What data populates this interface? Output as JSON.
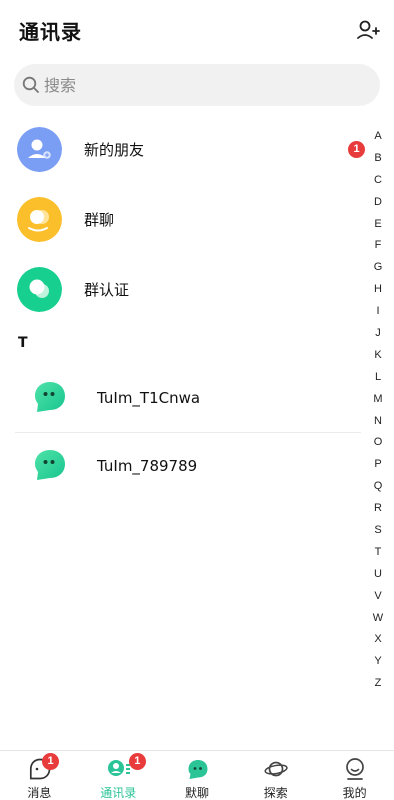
{
  "header": {
    "title": "通讯录",
    "add_friend_icon": "person-add-icon"
  },
  "search": {
    "placeholder": "搜索",
    "value": "",
    "icon": "search-icon"
  },
  "actions": [
    {
      "label": "新的朋友",
      "icon": "new-friend-icon",
      "color": "#7b9ef5",
      "badge": "1"
    },
    {
      "label": "群聊",
      "icon": "group-chat-icon",
      "color": "#fbbf2c"
    },
    {
      "label": "群认证",
      "icon": "group-verify-icon",
      "color": "#17cf8e"
    }
  ],
  "contacts": {
    "section": "T",
    "items": [
      {
        "name": "TuIm_T1Cnwa",
        "icon": "chat-bubble-avatar-icon"
      },
      {
        "name": "TuIm_789789",
        "icon": "chat-bubble-avatar-icon"
      }
    ]
  },
  "index_letters": [
    "A",
    "B",
    "C",
    "D",
    "E",
    "F",
    "G",
    "H",
    "I",
    "J",
    "K",
    "L",
    "M",
    "N",
    "O",
    "P",
    "Q",
    "R",
    "S",
    "T",
    "U",
    "V",
    "W",
    "X",
    "Y",
    "Z"
  ],
  "tabs": [
    {
      "label": "消息",
      "icon": "message-icon",
      "badge": "1",
      "active": false
    },
    {
      "label": "通讯录",
      "icon": "contacts-icon",
      "badge": "1",
      "active": true
    },
    {
      "label": "默聊",
      "icon": "chat-bubble-icon",
      "active": false
    },
    {
      "label": "探索",
      "icon": "planet-icon",
      "active": false
    },
    {
      "label": "我的",
      "icon": "profile-icon",
      "active": false
    }
  ],
  "colors": {
    "accent": "#2bc497",
    "badge": "#e83b3b"
  }
}
